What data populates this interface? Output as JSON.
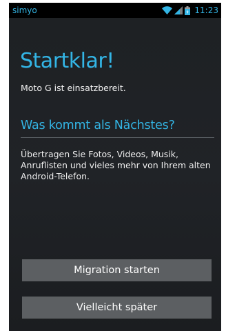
{
  "status_bar": {
    "carrier": "simyo",
    "time": "11:23",
    "icons": [
      "wifi-icon",
      "signal-icon",
      "battery-icon"
    ],
    "accent_color": "#33b5e5"
  },
  "main": {
    "title": "Startklar!",
    "subtitle": "Moto G ist einsatzbereit.",
    "section_heading": "Was kommt als Nächstes?",
    "description": "Übertragen Sie Fotos, Videos, Musik, Anruflisten und vieles mehr von Ihrem alten Android-Telefon."
  },
  "actions": {
    "migrate_label": "Migration starten",
    "later_label": "Vielleicht später"
  },
  "colors": {
    "accent": "#33b5e5",
    "background": "#202327",
    "button": "#5c5f62"
  }
}
